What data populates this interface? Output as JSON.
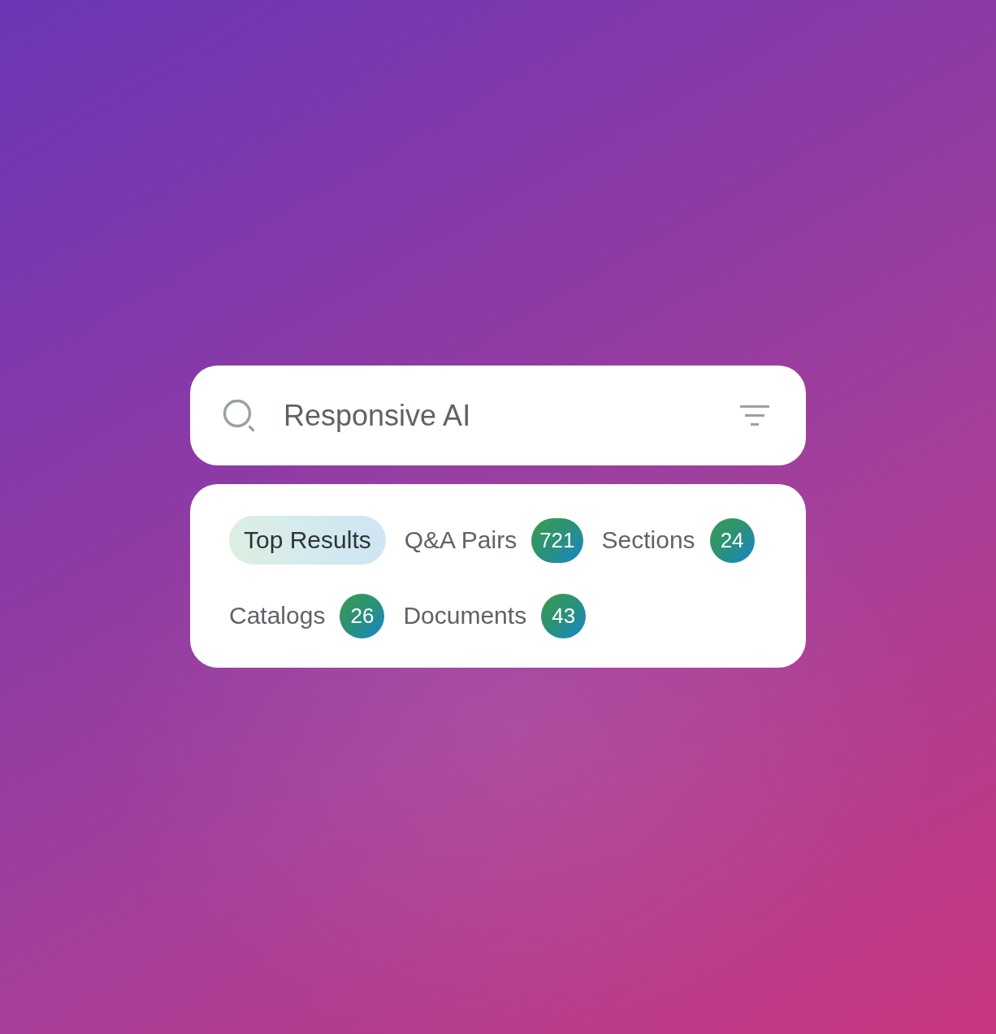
{
  "search": {
    "value": "Responsive AI"
  },
  "tabs": [
    {
      "label": "Top Results",
      "selected": true
    },
    {
      "label": "Q&A Pairs",
      "count": "721",
      "selected": false
    },
    {
      "label": "Sections",
      "count": "24",
      "selected": false
    },
    {
      "label": "Catalogs",
      "count": "26",
      "selected": false
    },
    {
      "label": "Documents",
      "count": "43",
      "selected": false
    }
  ]
}
